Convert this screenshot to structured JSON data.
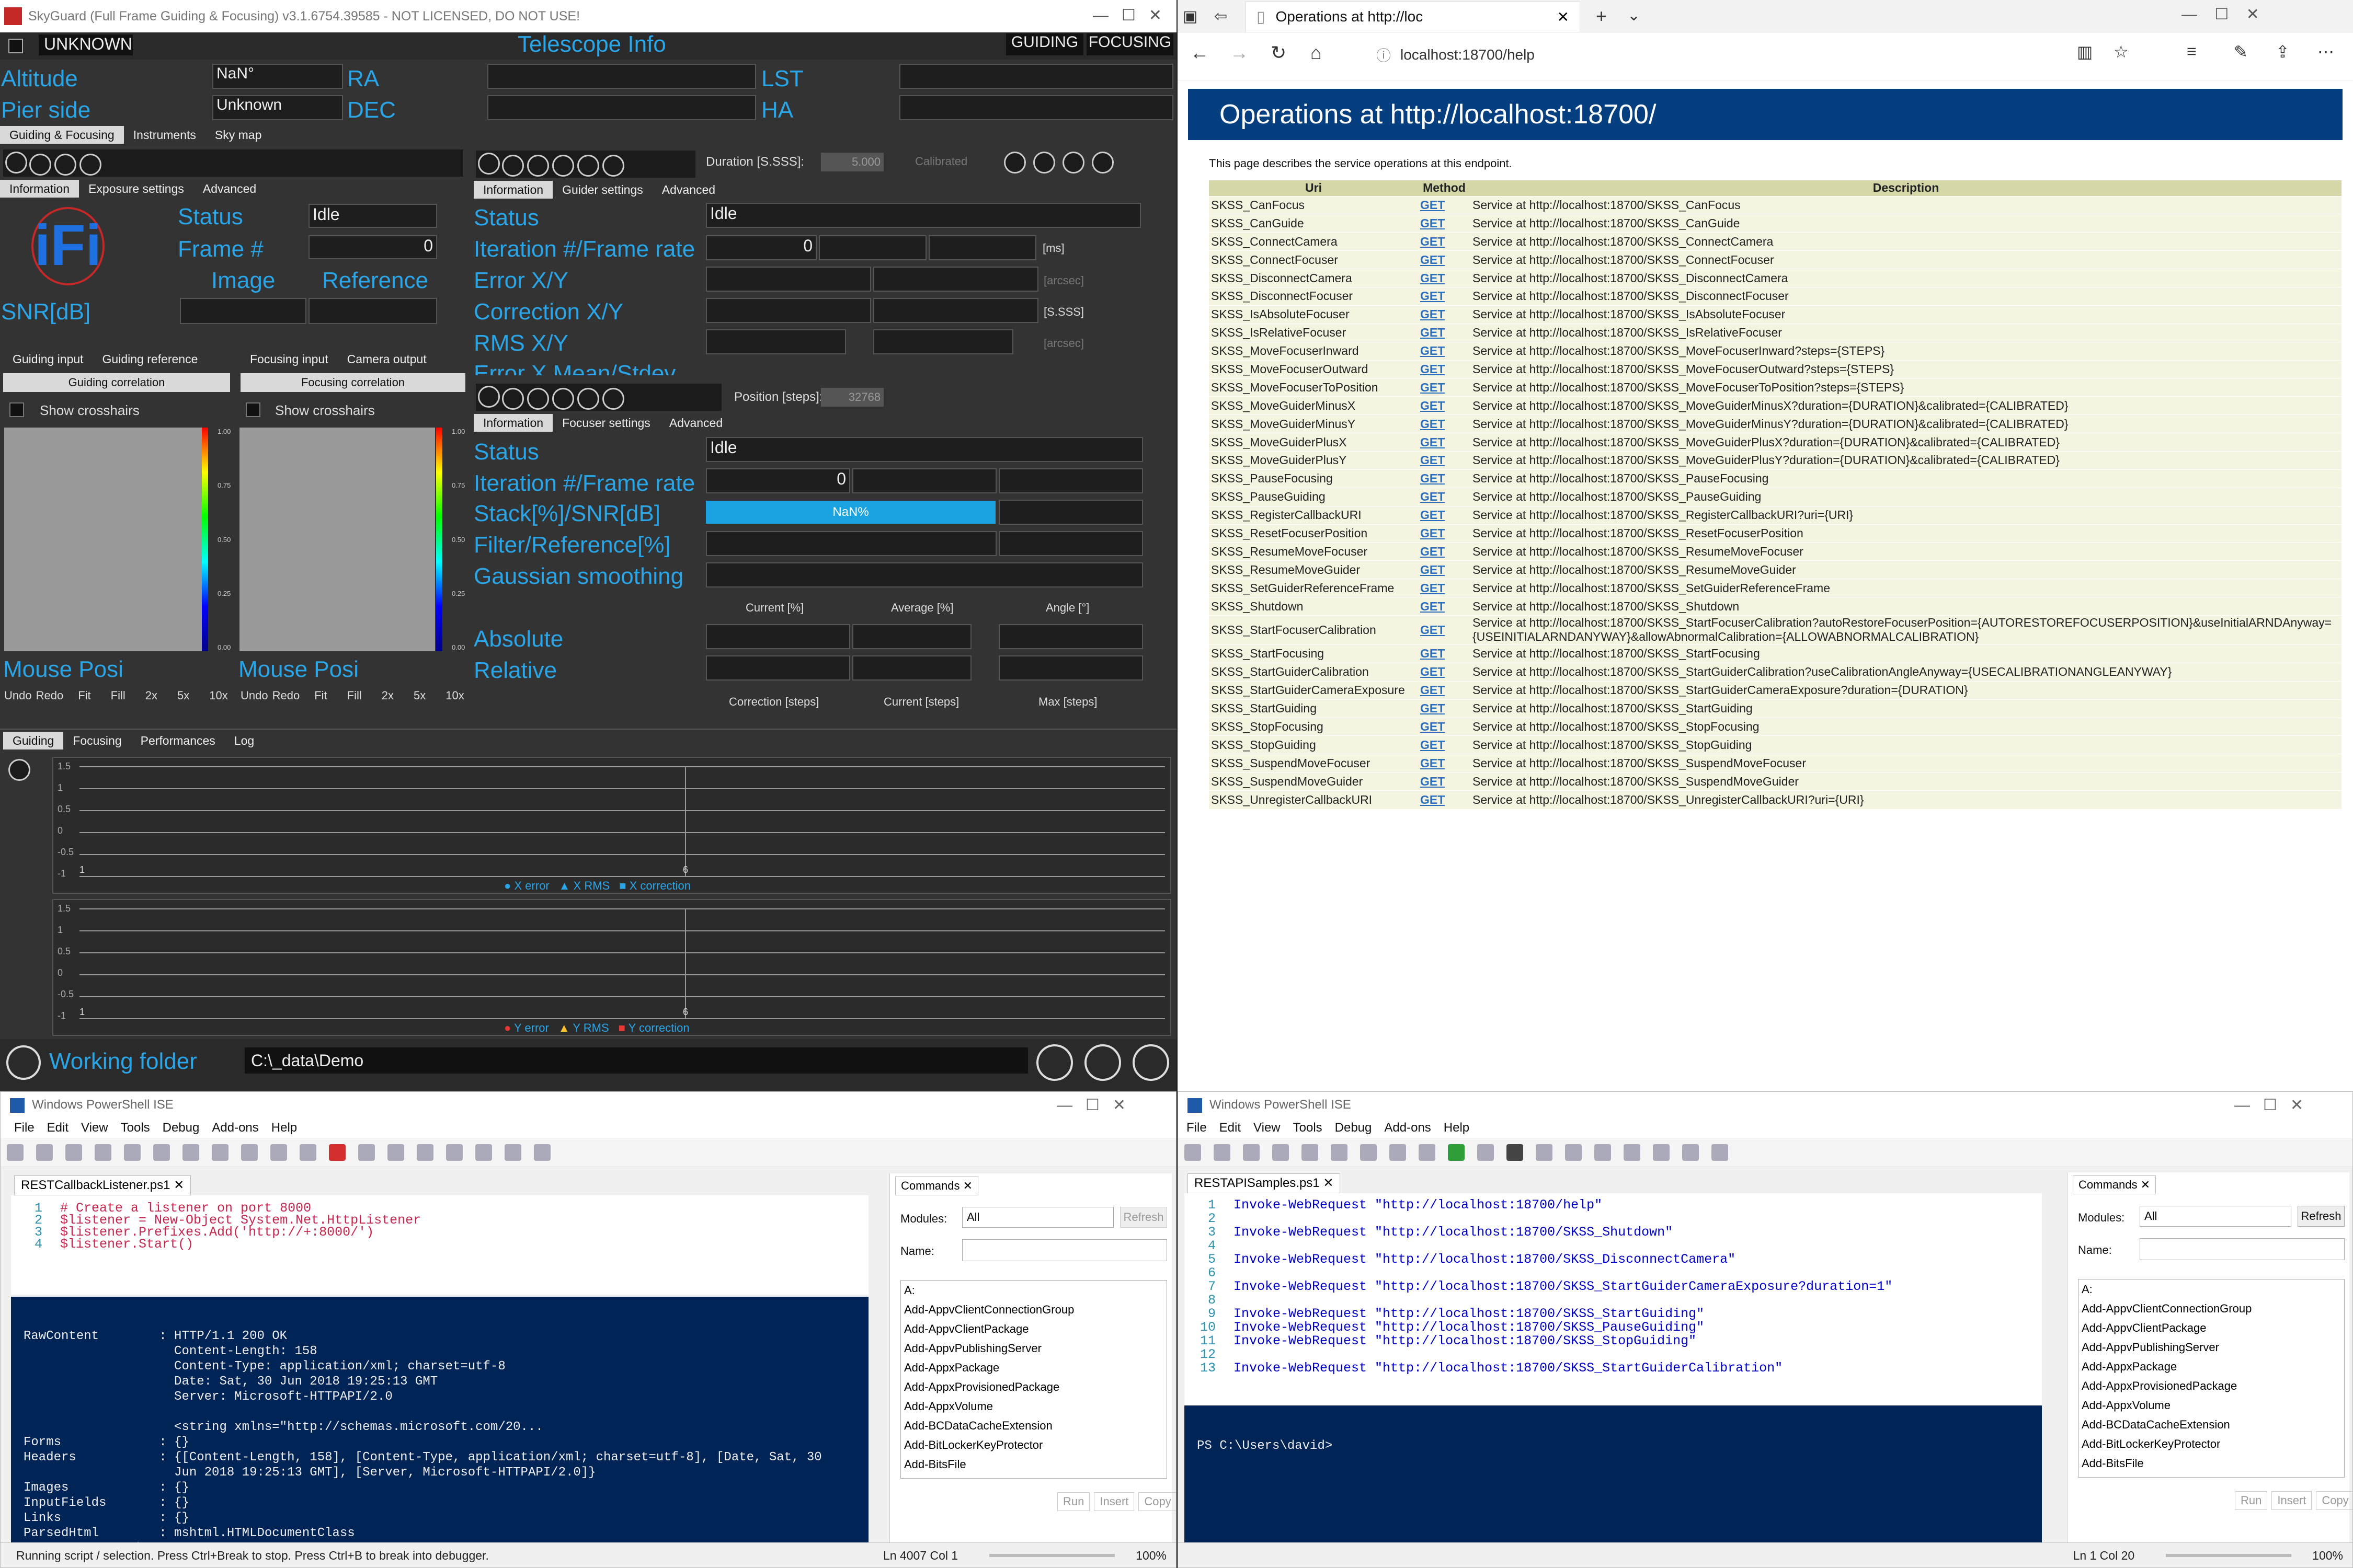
{
  "skyguard": {
    "title": "SkyGuard (Full Frame Guiding & Focusing) v3.1.6754.39585 - NOT LICENSED, DO NOT USE!",
    "state": "UNKNOWN",
    "header_center": "Telescope Info",
    "guiding_btn": "GUIDING",
    "focusing_btn": "FOCUSING",
    "altitude_label": "Altitude",
    "altitude_value": "NaN°",
    "ra_label": "RA",
    "lst_label": "LST",
    "pier_label": "Pier side",
    "pier_value": "Unknown",
    "dec_label": "DEC",
    "ha_label": "HA",
    "main_tabs": [
      "Guiding & Focusing",
      "Instruments",
      "Sky map"
    ],
    "left_subtabs": [
      "Information",
      "Exposure settings",
      "Advanced"
    ],
    "left_status_label": "Status",
    "left_status_value": "Idle",
    "frame_label": "Frame #",
    "frame_value": "0",
    "image_label": "Image",
    "reference_label": "Reference",
    "snr_label": "SNR[dB]",
    "guider_subtabs": [
      "Information",
      "Guider settings",
      "Advanced"
    ],
    "duration_label": "Duration [S.SSS]:",
    "duration_value": "5.000",
    "calibrated_label": "Calibrated",
    "g_status_label": "Status",
    "g_status_value": "Idle",
    "g_iter_label": "Iteration #/Frame rate",
    "g_iter_value": "0",
    "g_ms": "[ms]",
    "g_error_label": "Error X/Y",
    "g_arcsec": "[arcsec]",
    "g_corr_label": "Correction X/Y",
    "g_sss": "[S.SSS]",
    "g_rms_label": "RMS X/Y",
    "g_arcsec2": "[arcsec]",
    "g_cut_label": "Error X Mean/Stdev",
    "panel_tabs_left": [
      "Guiding input",
      "Guiding reference"
    ],
    "panel_tabs_right": [
      "Focusing input",
      "Camera output"
    ],
    "guiding_corr_btn": "Guiding correlation",
    "focusing_corr_btn": "Focusing correlation",
    "show_crosshairs": "Show crosshairs",
    "scale_ticks": [
      "1.00",
      "0.75",
      "0.50",
      "0.25",
      "0.00"
    ],
    "mouse_pos": "Mouse Posi",
    "view_btns": [
      "Undo",
      "Redo",
      "Fit",
      "Fill",
      "2x",
      "5x",
      "10x"
    ],
    "focuser_subtabs": [
      "Information",
      "Focuser settings",
      "Advanced"
    ],
    "position_label": "Position [steps]:",
    "position_value": "32768",
    "f_status_label": "Status",
    "f_status_value": "Idle",
    "f_iter_label": "Iteration #/Frame rate",
    "f_iter_value": "0",
    "f_stack_label": "Stack[%]/SNR[dB]",
    "f_stack_value": "NaN%",
    "f_filter_label": "Filter/Reference[%]",
    "f_gauss_label": "Gaussian smoothing",
    "col_current": "Current [%]",
    "col_average": "Average [%]",
    "col_angle": "Angle [°]",
    "f_absolute": "Absolute",
    "f_relative": "Relative",
    "col_correction": "Correction [steps]",
    "col_current_steps": "Current [steps]",
    "col_max": "Max [steps]",
    "bottom_tabs": [
      "Guiding",
      "Focusing",
      "Performances",
      "Log"
    ],
    "y_ticks": [
      "1.5",
      "1",
      "0.5",
      "0",
      "-0.5",
      "-1"
    ],
    "x_ticks": [
      "1",
      "6"
    ],
    "legend_x": [
      "X error",
      "X RMS",
      "X correction"
    ],
    "legend_y": [
      "Y error",
      "Y RMS",
      "Y correction"
    ],
    "working_folder_label": "Working folder",
    "working_folder_value": "C:\\_data\\Demo"
  },
  "edge": {
    "tab_title": "Operations at http://loc",
    "address": "localhost:18700/help",
    "heading": "Operations at http://localhost:18700/",
    "intro": "This page describes the service operations at this endpoint.",
    "col_uri": "Uri",
    "col_method": "Method",
    "col_desc": "Description",
    "rows": [
      [
        "SKSS_CanFocus",
        "GET",
        "Service at http://localhost:18700/SKSS_CanFocus"
      ],
      [
        "SKSS_CanGuide",
        "GET",
        "Service at http://localhost:18700/SKSS_CanGuide"
      ],
      [
        "SKSS_ConnectCamera",
        "GET",
        "Service at http://localhost:18700/SKSS_ConnectCamera"
      ],
      [
        "SKSS_ConnectFocuser",
        "GET",
        "Service at http://localhost:18700/SKSS_ConnectFocuser"
      ],
      [
        "SKSS_DisconnectCamera",
        "GET",
        "Service at http://localhost:18700/SKSS_DisconnectCamera"
      ],
      [
        "SKSS_DisconnectFocuser",
        "GET",
        "Service at http://localhost:18700/SKSS_DisconnectFocuser"
      ],
      [
        "SKSS_IsAbsoluteFocuser",
        "GET",
        "Service at http://localhost:18700/SKSS_IsAbsoluteFocuser"
      ],
      [
        "SKSS_IsRelativeFocuser",
        "GET",
        "Service at http://localhost:18700/SKSS_IsRelativeFocuser"
      ],
      [
        "SKSS_MoveFocuserInward",
        "GET",
        "Service at http://localhost:18700/SKSS_MoveFocuserInward?steps={STEPS}"
      ],
      [
        "SKSS_MoveFocuserOutward",
        "GET",
        "Service at http://localhost:18700/SKSS_MoveFocuserOutward?steps={STEPS}"
      ],
      [
        "SKSS_MoveFocuserToPosition",
        "GET",
        "Service at http://localhost:18700/SKSS_MoveFocuserToPosition?steps={STEPS}"
      ],
      [
        "SKSS_MoveGuiderMinusX",
        "GET",
        "Service at http://localhost:18700/SKSS_MoveGuiderMinusX?duration={DURATION}&calibrated={CALIBRATED}"
      ],
      [
        "SKSS_MoveGuiderMinusY",
        "GET",
        "Service at http://localhost:18700/SKSS_MoveGuiderMinusY?duration={DURATION}&calibrated={CALIBRATED}"
      ],
      [
        "SKSS_MoveGuiderPlusX",
        "GET",
        "Service at http://localhost:18700/SKSS_MoveGuiderPlusX?duration={DURATION}&calibrated={CALIBRATED}"
      ],
      [
        "SKSS_MoveGuiderPlusY",
        "GET",
        "Service at http://localhost:18700/SKSS_MoveGuiderPlusY?duration={DURATION}&calibrated={CALIBRATED}"
      ],
      [
        "SKSS_PauseFocusing",
        "GET",
        "Service at http://localhost:18700/SKSS_PauseFocusing"
      ],
      [
        "SKSS_PauseGuiding",
        "GET",
        "Service at http://localhost:18700/SKSS_PauseGuiding"
      ],
      [
        "SKSS_RegisterCallbackURI",
        "GET",
        "Service at http://localhost:18700/SKSS_RegisterCallbackURI?uri={URI}"
      ],
      [
        "SKSS_ResetFocuserPosition",
        "GET",
        "Service at http://localhost:18700/SKSS_ResetFocuserPosition"
      ],
      [
        "SKSS_ResumeMoveFocuser",
        "GET",
        "Service at http://localhost:18700/SKSS_ResumeMoveFocuser"
      ],
      [
        "SKSS_ResumeMoveGuider",
        "GET",
        "Service at http://localhost:18700/SKSS_ResumeMoveGuider"
      ],
      [
        "SKSS_SetGuiderReferenceFrame",
        "GET",
        "Service at http://localhost:18700/SKSS_SetGuiderReferenceFrame"
      ],
      [
        "SKSS_Shutdown",
        "GET",
        "Service at http://localhost:18700/SKSS_Shutdown"
      ],
      [
        "SKSS_StartFocuserCalibration",
        "GET",
        "Service at http://localhost:18700/SKSS_StartFocuserCalibration?autoRestoreFocuserPosition={AUTORESTOREFOCUSERPOSITION}&useInitialARNDAnyway={USEINITIALARNDANYWAY}&allowAbnormalCalibration={ALLOWABNORMALCALIBRATION}"
      ],
      [
        "SKSS_StartFocusing",
        "GET",
        "Service at http://localhost:18700/SKSS_StartFocusing"
      ],
      [
        "SKSS_StartGuiderCalibration",
        "GET",
        "Service at http://localhost:18700/SKSS_StartGuiderCalibration?useCalibrationAngleAnyway={USECALIBRATIONANGLEANYWAY}"
      ],
      [
        "SKSS_StartGuiderCameraExposure",
        "GET",
        "Service at http://localhost:18700/SKSS_StartGuiderCameraExposure?duration={DURATION}"
      ],
      [
        "SKSS_StartGuiding",
        "GET",
        "Service at http://localhost:18700/SKSS_StartGuiding"
      ],
      [
        "SKSS_StopFocusing",
        "GET",
        "Service at http://localhost:18700/SKSS_StopFocusing"
      ],
      [
        "SKSS_StopGuiding",
        "GET",
        "Service at http://localhost:18700/SKSS_StopGuiding"
      ],
      [
        "SKSS_SuspendMoveFocuser",
        "GET",
        "Service at http://localhost:18700/SKSS_SuspendMoveFocuser"
      ],
      [
        "SKSS_SuspendMoveGuider",
        "GET",
        "Service at http://localhost:18700/SKSS_SuspendMoveGuider"
      ],
      [
        "SKSS_UnregisterCallbackURI",
        "GET",
        "Service at http://localhost:18700/SKSS_UnregisterCallbackURI?uri={URI}"
      ]
    ]
  },
  "ps_left": {
    "title": "Windows PowerShell ISE",
    "menu": [
      "File",
      "Edit",
      "View",
      "Tools",
      "Debug",
      "Add-ons",
      "Help"
    ],
    "tab": "RESTCallbackListener.ps1",
    "code_lines": [
      [
        "1",
        "# Create a listener on port 8000"
      ],
      [
        "2",
        "$listener = New-Object System.Net.HttpListener"
      ],
      [
        "3",
        "$listener.Prefixes.Add('http://+:8000/')"
      ],
      [
        "4",
        "$listener.Start()"
      ]
    ],
    "console_lines": [
      "RawContent        : HTTP/1.1 200 OK",
      "                    Content-Length: 158",
      "                    Content-Type: application/xml; charset=utf-8",
      "                    Date: Sat, 30 Jun 2018 19:25:13 GMT",
      "                    Server: Microsoft-HTTPAPI/2.0",
      "",
      "                    <string xmlns=\"http://schemas.microsoft.com/20...",
      "Forms             : {}",
      "Headers           : {[Content-Length, 158], [Content-Type, application/xml; charset=utf-8], [Date, Sat, 30",
      "                    Jun 2018 19:25:13 GMT], [Server, Microsoft-HTTPAPI/2.0]}",
      "Images            : {}",
      "InputFields       : {}",
      "Links             : {}",
      "ParsedHtml        : mshtml.HTMLDocumentClass",
      "RawContentLength  : 158"
    ],
    "commands_title": "Commands",
    "modules_label": "Modules:",
    "modules_value": "All",
    "refresh": "Refresh",
    "name_label": "Name:",
    "cmd_list": [
      "A:",
      "Add-AppvClientConnectionGroup",
      "Add-AppvClientPackage",
      "Add-AppvPublishingServer",
      "Add-AppxPackage",
      "Add-AppxProvisionedPackage",
      "Add-AppxVolume",
      "Add-BCDataCacheExtension",
      "Add-BitLockerKeyProtector",
      "Add-BitsFile"
    ],
    "run": "Run",
    "insert": "Insert",
    "copy": "Copy",
    "status": "Running script / selection.  Press Ctrl+Break to stop.  Press Ctrl+B to break into debugger.",
    "pos": "Ln 4007  Col 1",
    "zoom": "100%"
  },
  "ps_right": {
    "title": "Windows PowerShell ISE",
    "menu": [
      "File",
      "Edit",
      "View",
      "Tools",
      "Debug",
      "Add-ons",
      "Help"
    ],
    "tab": "RESTAPISamples.ps1",
    "code_lines": [
      [
        "1",
        "Invoke-WebRequest \"http://localhost:18700/help\""
      ],
      [
        "2",
        ""
      ],
      [
        "3",
        "Invoke-WebRequest \"http://localhost:18700/SKSS_Shutdown\""
      ],
      [
        "4",
        ""
      ],
      [
        "5",
        "Invoke-WebRequest \"http://localhost:18700/SKSS_DisconnectCamera\""
      ],
      [
        "6",
        ""
      ],
      [
        "7",
        "Invoke-WebRequest \"http://localhost:18700/SKSS_StartGuiderCameraExposure?duration=1\""
      ],
      [
        "8",
        ""
      ],
      [
        "9",
        "Invoke-WebRequest \"http://localhost:18700/SKSS_StartGuiding\""
      ],
      [
        "10",
        "Invoke-WebRequest \"http://localhost:18700/SKSS_PauseGuiding\""
      ],
      [
        "11",
        "Invoke-WebRequest \"http://localhost:18700/SKSS_StopGuiding\""
      ],
      [
        "12",
        ""
      ],
      [
        "13",
        "Invoke-WebRequest \"http://localhost:18700/SKSS_StartGuiderCalibration\""
      ]
    ],
    "prompt": "PS C:\\Users\\david>",
    "commands_title": "Commands",
    "modules_label": "Modules:",
    "modules_value": "All",
    "refresh": "Refresh",
    "name_label": "Name:",
    "cmd_list": [
      "A:",
      "Add-AppvClientConnectionGroup",
      "Add-AppvClientPackage",
      "Add-AppvPublishingServer",
      "Add-AppxPackage",
      "Add-AppxProvisionedPackage",
      "Add-AppxVolume",
      "Add-BCDataCacheExtension",
      "Add-BitLockerKeyProtector",
      "Add-BitsFile"
    ],
    "run": "Run",
    "insert": "Insert",
    "copy": "Copy",
    "pos": "Ln 1  Col 20",
    "zoom": "100%"
  }
}
